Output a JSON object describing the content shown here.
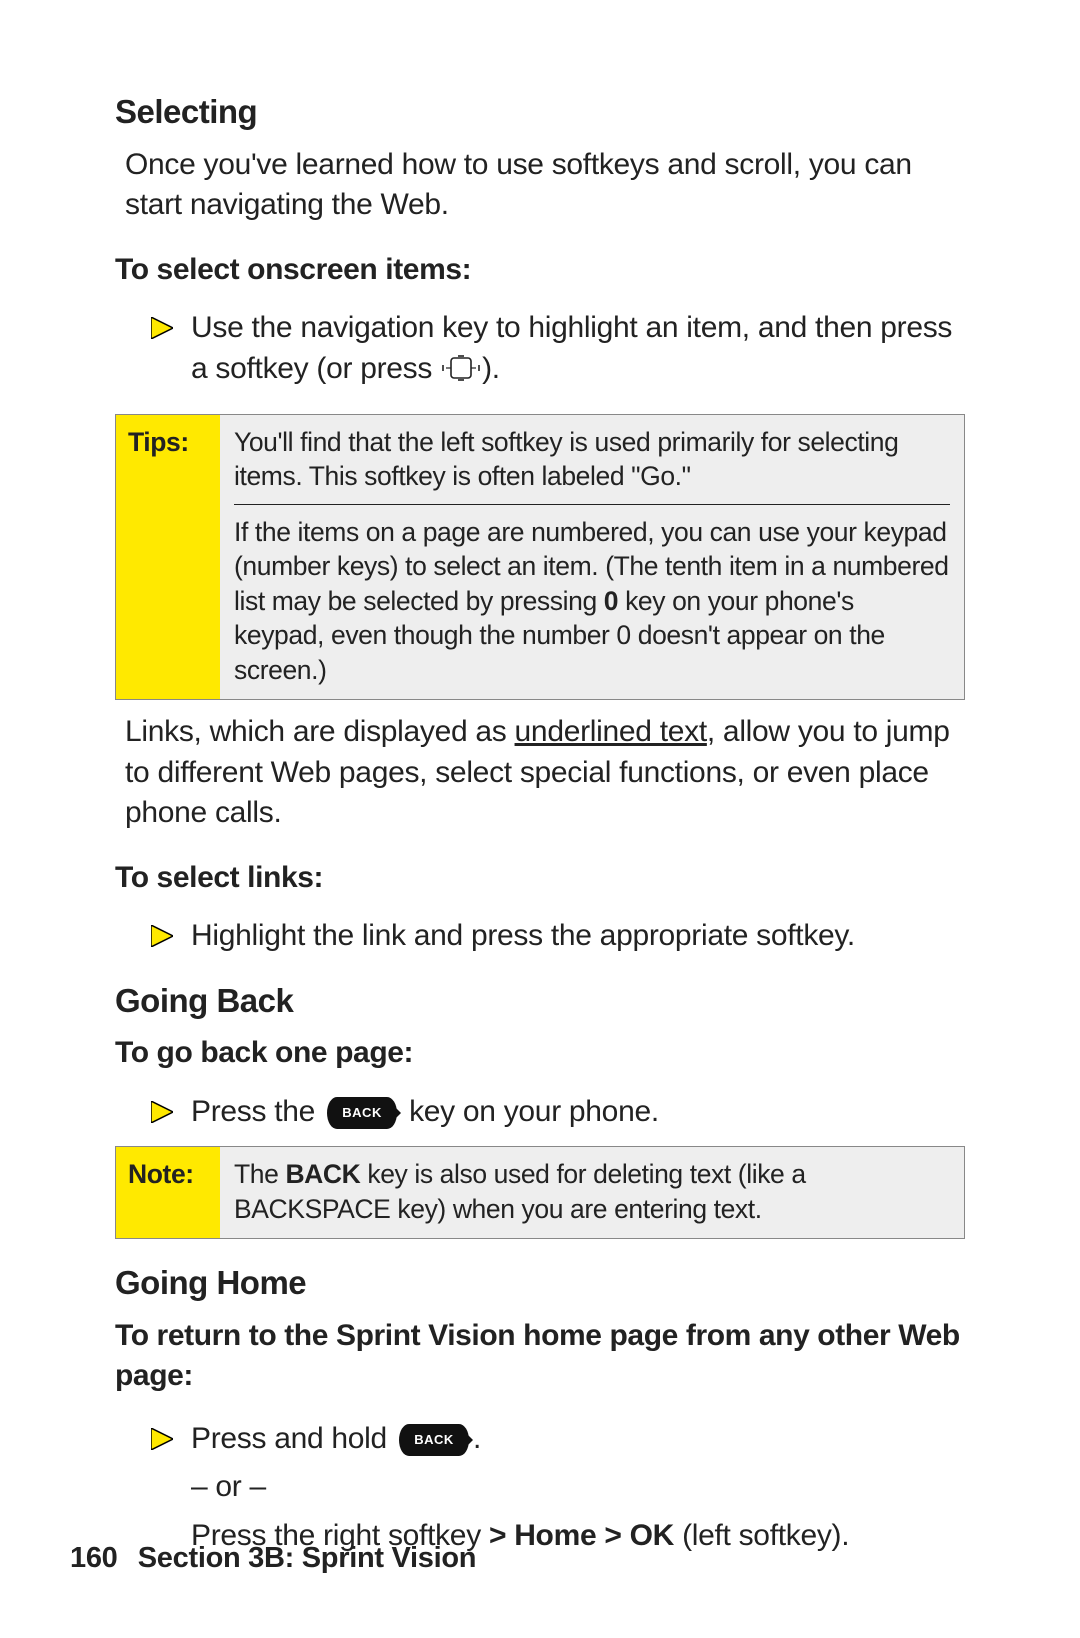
{
  "headings": {
    "selecting": "Selecting",
    "goingBack": "Going Back",
    "goingHome": "Going Home"
  },
  "selecting": {
    "intro": "Once you've learned how to use softkeys and scroll, you can start navigating the Web.",
    "sub1": "To select onscreen items:",
    "bullet1_a": "Use the navigation key to highlight an item, and then press a softkey (or press ",
    "bullet1_b": ").",
    "afterTips_a": "Links, which are displayed as ",
    "afterTips_link": "underlined text",
    "afterTips_b": ", allow you to jump to different Web pages, select special functions, or even place phone calls.",
    "sub2": "To select links:",
    "bullet2": "Highlight the link and press the appropriate softkey."
  },
  "tips": {
    "label": "Tips:",
    "row1": "You'll find that the left softkey is used primarily for selecting items. This softkey is often labeled \"Go.\"",
    "row2_a": "If the items on a page are numbered, you can use your keypad (number keys) to select an item. (The tenth item in a numbered list may be selected by pressing ",
    "row2_key": "0",
    "row2_b": " key on your phone's keypad, even though the number 0 doesn't appear on the screen.)"
  },
  "goingBack": {
    "sub": "To go back one page:",
    "bullet_a": "Press the ",
    "bullet_b": " key on your phone.",
    "backKeyLabel": "BACK"
  },
  "note": {
    "label": "Note:",
    "text_a": "The ",
    "text_key": "BACK",
    "text_b": " key is also used for deleting text (like a BACKSPACE key) when you are entering text."
  },
  "goingHome": {
    "sub": "To return to the Sprint Vision home page from any other Web page:",
    "bullet_a": "Press and hold ",
    "bullet_b": ".",
    "or": "– or –",
    "alt_a": "Press the right softkey ",
    "alt_b": "> Home > OK",
    "alt_c": " (left softkey)."
  },
  "footer": {
    "page": "160",
    "section": "Section 3B: Sprint Vision"
  }
}
